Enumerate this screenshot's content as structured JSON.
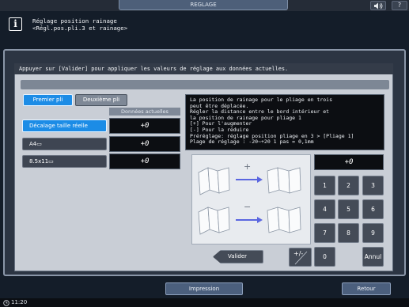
{
  "top_bar": {
    "title": "REGLAGE",
    "volume_icon": "speaker-icon",
    "help_label": "?"
  },
  "header": {
    "icon": "info-icon",
    "icon_glyph": "i",
    "line1": "Réglage position rainage",
    "line2": "<Régl.pos.pli.3 et rainage>"
  },
  "instruction": "Appuyer sur [Valider] pour appliquer les valeurs de réglage aux données actuelles.",
  "tabs": [
    {
      "label": "Premier pli",
      "selected": true
    },
    {
      "label": "Deuxième pli",
      "selected": false
    }
  ],
  "current_data_header": "Données actuelles",
  "adjust_rows": [
    {
      "label": "Décalage taille réelle",
      "value": "+0",
      "selected": true
    },
    {
      "label": "A4▭",
      "value": "+0",
      "selected": false
    },
    {
      "label": "8.5x11▭",
      "value": "+0",
      "selected": false
    }
  ],
  "description_lines": [
    "La position de rainage pour le pliage en trois",
    "peut être déplacée.",
    "Régler la distance entre le bord intérieur et",
    "la position de rainage pour pliage 1",
    "[+] Pour l'augmenter",
    "[-] Pour la réduire",
    "Préréglage: réglage position pliage en 3 > [Pliage 1]",
    "Plage de réglage : -20~+20 1 pas = 0,1mm"
  ],
  "diagram": {
    "plus_sign": "+",
    "minus_sign": "−"
  },
  "input_display": "+0",
  "keypad": {
    "keys": [
      "1",
      "2",
      "3",
      "4",
      "5",
      "6",
      "7",
      "8",
      "9"
    ],
    "zero": "0",
    "clear": "Annul",
    "plus_minus": "+/-"
  },
  "valider_label": "Valider",
  "bottom": {
    "print_label": "Impression",
    "back_label": "Retour"
  },
  "status": {
    "time": "11:20",
    "clock_icon": "clock-icon"
  },
  "colors": {
    "accent": "#1c8ce6",
    "arrow": "#5a66e0"
  }
}
